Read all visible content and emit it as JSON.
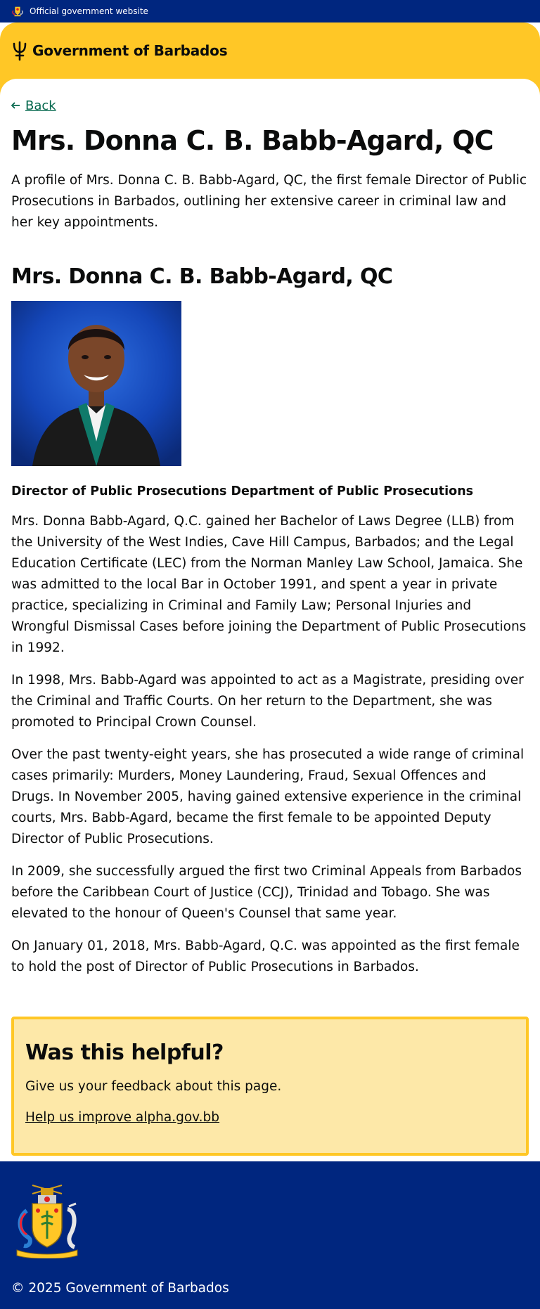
{
  "topbar": {
    "official_label": "Official government website"
  },
  "header": {
    "brand": "Government of Barbados"
  },
  "nav": {
    "back_label": "Back"
  },
  "page": {
    "title": "Mrs. Donna C. B. Babb-Agard, QC",
    "summary": "A profile of Mrs. Donna C. B. Babb-Agard, QC, the first female Director of Public Prosecutions in Barbados, outlining her extensive career in criminal law and her key appointments.",
    "profile_heading": "Mrs. Donna C. B. Babb-Agard, QC",
    "role": "Director of Public Prosecutions Department of Public Prosecutions",
    "bio": [
      "Mrs. Donna Babb-Agard, Q.C. gained her Bachelor of Laws Degree (LLB) from the University of the West Indies, Cave Hill Campus, Barbados; and the Legal Education Certificate (LEC) from the Norman Manley Law School, Jamaica. She was admitted to the local Bar in October 1991, and spent a year in private practice, specializing in Criminal and Family Law; Personal Injuries and Wrongful Dismissal Cases before joining the Department of Public Prosecutions in 1992.",
      "In 1998, Mrs. Babb-Agard was appointed to act as a Magistrate, presiding over the Criminal and Traffic Courts. On her return to the Department, she was promoted to Principal Crown Counsel.",
      "Over the past twenty-eight years, she has prosecuted a wide range of criminal cases primarily: Murders, Money Laundering, Fraud, Sexual Offences and Drugs. In November 2005, having gained extensive experience in the criminal courts, Mrs. Babb-Agard, became the first female to be appointed Deputy Director of Public Prosecutions.",
      "In 2009, she successfully argued the first two Criminal Appeals from Barbados before the Caribbean Court of Justice (CCJ), Trinidad and Tobago. She was elevated to the honour of Queen's Counsel that same year.",
      "On January 01, 2018, Mrs. Babb-Agard, Q.C. was appointed as the first female to hold the post of Director of Public Prosecutions in Barbados."
    ]
  },
  "feedback": {
    "heading": "Was this helpful?",
    "text": "Give us your feedback about this page.",
    "link": "Help us improve alpha.gov.bb"
  },
  "footer": {
    "copyright": "© 2025 Government of Barbados"
  },
  "colors": {
    "navy": "#00267f",
    "gold": "#ffc726",
    "link_green": "#00654a",
    "feedback_bg": "#fde8a8"
  },
  "icons": {
    "topbar": "coat-of-arms-icon",
    "header": "trident-icon",
    "back": "arrow-left-icon",
    "footer": "coat-of-arms-icon"
  }
}
